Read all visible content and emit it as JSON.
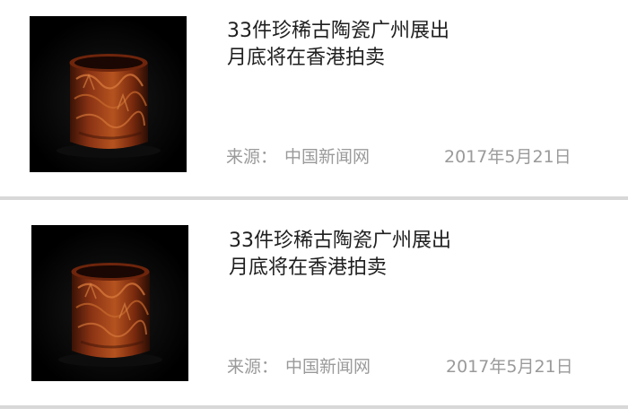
{
  "feed": {
    "items": [
      {
        "image_icon": "carved-lacquer-brush-pot-photo",
        "title_line1": "33件珍稀古陶瓷广州展出",
        "title_line2": "月底将在香港拍卖",
        "source_label": "来源：",
        "source_name": "中国新闻网",
        "date": "2017年5月21日"
      },
      {
        "image_icon": "carved-lacquer-brush-pot-photo",
        "title_line1": "33件珍稀古陶瓷广州展出",
        "title_line2": "月底将在香港拍卖",
        "source_label": "来源：",
        "source_name": "中国新闻网",
        "date": "2017年5月21日"
      }
    ]
  },
  "colors": {
    "title": "#1f1f1f",
    "meta": "#9a9a9a",
    "separator": "#d8d8d8",
    "thumb_bg": "#000000",
    "lacquer": "#9c3a16"
  }
}
